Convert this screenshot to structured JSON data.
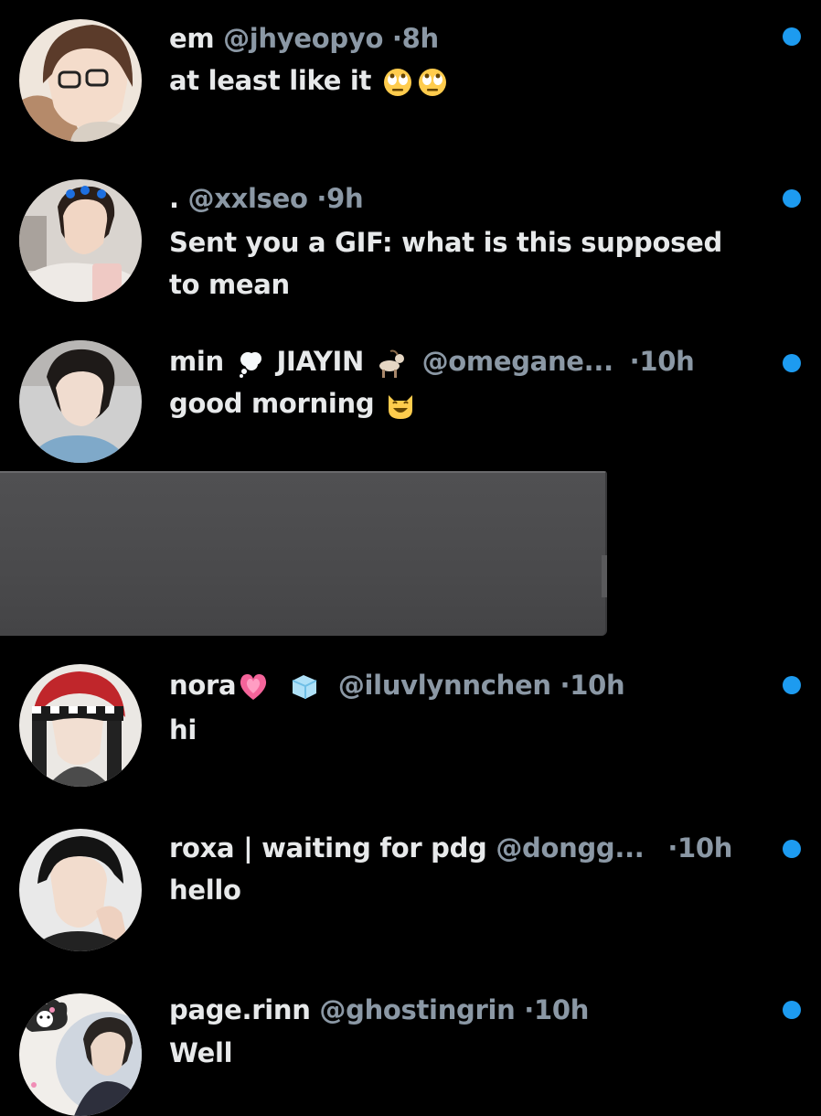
{
  "accent_color": "#1d9bf0",
  "muted_color": "#8b98a5",
  "conversations": [
    {
      "name": "em",
      "handle": "@jhyeopyo",
      "separator": "·",
      "time": "8h",
      "message": "at least like it",
      "message_emojis": [
        "face-with-rolling-eyes-emoji",
        "face-with-rolling-eyes-emoji"
      ],
      "unread": true
    },
    {
      "name": ".",
      "handle": "@xxlseo",
      "separator": "·",
      "time": "9h",
      "message_line1": "Sent you a GIF: what is this supposed",
      "message_line2": "to mean",
      "unread": true
    },
    {
      "name": "min",
      "name_emoji": "thought-balloon-emoji",
      "name_part2": "JIAYIN",
      "name_emoji2": "goat-emoji",
      "handle": "@omegane...",
      "separator": "·",
      "time": "10h",
      "message": "good morning",
      "message_emojis": [
        "grinning-cat-emoji"
      ],
      "unread": true
    },
    {
      "name": "nora",
      "name_emoji": "growing-heart-emoji",
      "name_emoji2": "ice-cube-emoji",
      "handle": "@iluvlynnchen",
      "separator": "·",
      "time": "10h",
      "message": "hi",
      "unread": true
    },
    {
      "name": "roxa | waiting for pdg",
      "handle": "@dongg...",
      "separator": "·",
      "time": "10h",
      "message": "hello",
      "unread": true
    },
    {
      "name": "page.rinn",
      "handle": "@ghostingrin",
      "separator": "·",
      "time": "10h",
      "message": "Well",
      "unread": true
    }
  ]
}
